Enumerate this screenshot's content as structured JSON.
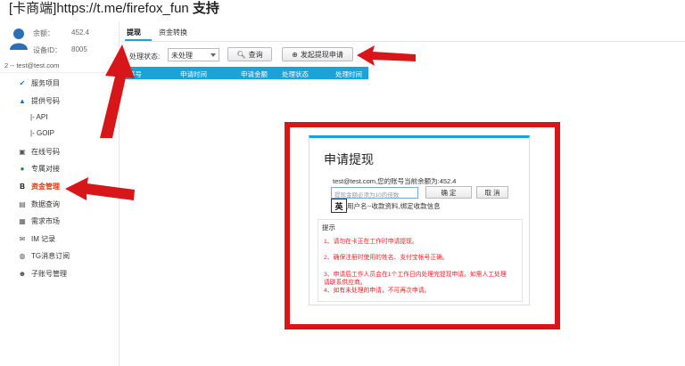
{
  "banner": {
    "bracket_text": "[卡商端]",
    "url": "https://t.me/firefox_fun",
    "support": "支持"
  },
  "account": {
    "balance_label": "余额：",
    "balance_value": "452.4",
    "device_label": "设备ID：",
    "device_value": "8005",
    "user_line": "2 -- test@test.com"
  },
  "sidebar": {
    "items": [
      {
        "label": "服务项目",
        "icon": "service-icon"
      },
      {
        "label": "提供号码",
        "icon": "phone-icon"
      },
      {
        "label": "|- API"
      },
      {
        "label": "|- GOIP"
      },
      {
        "label": "在线号码",
        "icon": "online-icon"
      },
      {
        "label": "专属对接",
        "icon": "connect-icon"
      },
      {
        "label": "资金管理",
        "icon": "fund-icon",
        "active": true
      },
      {
        "label": "数据查询",
        "icon": "data-icon"
      },
      {
        "label": "需求市场",
        "icon": "market-icon"
      },
      {
        "label": "IM 记录",
        "icon": "mail-icon"
      },
      {
        "label": "TG消息订阅",
        "icon": "tg-icon"
      },
      {
        "label": "子账号管理",
        "icon": "subaccount-icon"
      }
    ]
  },
  "tabs": [
    {
      "label": "提现",
      "active": true
    },
    {
      "label": "资金转换",
      "active": false
    }
  ],
  "filter": {
    "status_label": "处理状态:",
    "status_value": "未处理",
    "query_label": "查询",
    "apply_label": "发起提现申请"
  },
  "table": {
    "columns": [
      "序号",
      "申请时间",
      "申请金额",
      "处理状态",
      "处理时间"
    ]
  },
  "dialog": {
    "title": "申请提现",
    "info": "test@test.com,您的账号当前余额为:452.4",
    "amount_placeholder": "提现金额必须为10的倍数",
    "ok_label": "确 定",
    "cancel_label": "取 消",
    "ime_char": "英",
    "collect_line": "用户名--收款资料,绑定收款信息",
    "tips_title": "提示",
    "tips": [
      "1、请勿在卡正在工作时申请提现。",
      "2、确保注册时使用的姓名、支付宝帐号正确。",
      "3、申请后工作人员会在1个工作日内处理完提现申请。如需人工处理",
      "请联系供应商。",
      "4、如有未处理的申请，不可再次申请。"
    ]
  },
  "colors": {
    "accent": "#19a3d9",
    "annotation_red": "#d7161a",
    "active_menu": "#e8380d",
    "tip_text": "#e8262a"
  }
}
